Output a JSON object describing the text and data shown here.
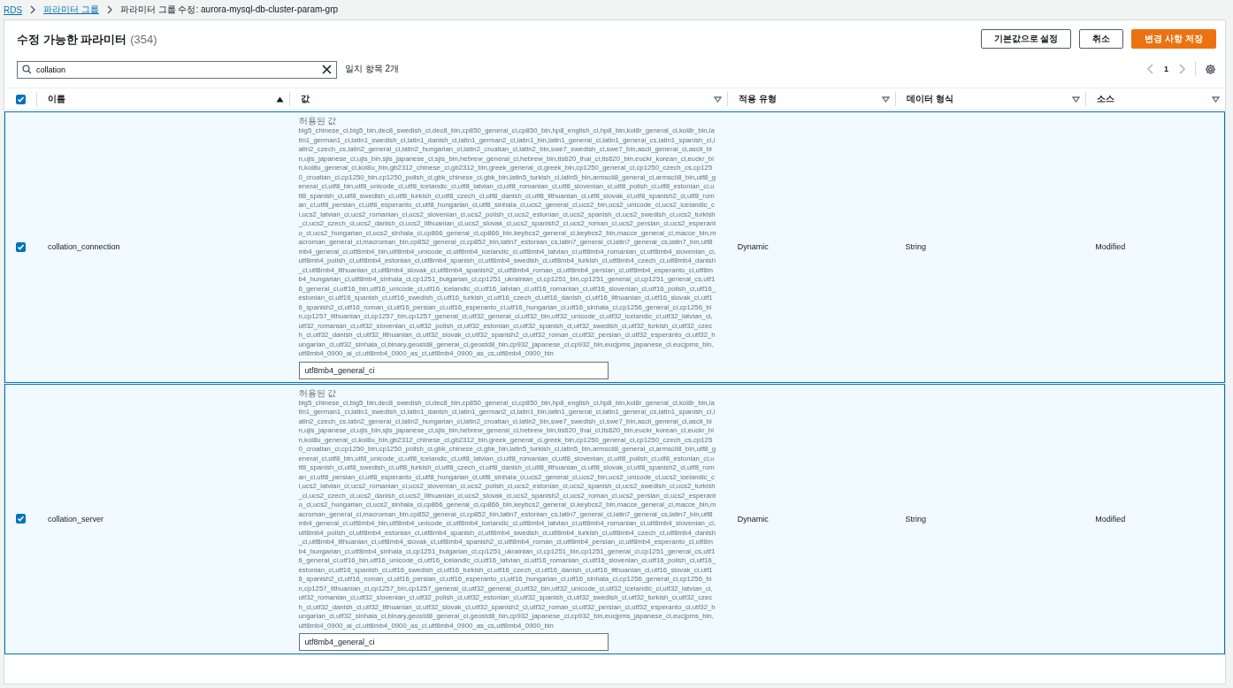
{
  "breadcrumb": [
    {
      "label": "RDS",
      "link": true
    },
    {
      "label": "파라미터 그룹",
      "link": true
    },
    {
      "label": "파라미터 그룹 수정: aurora-mysql-db-cluster-param-grp",
      "link": false
    }
  ],
  "panel": {
    "title": "수정 가능한 파라미터",
    "count": "(354)",
    "buttons": [
      {
        "label": "기본값으로 설정",
        "kind": "normal"
      },
      {
        "label": "취소",
        "kind": "normal"
      },
      {
        "label": "변경 사항 저장",
        "kind": "primary"
      }
    ]
  },
  "search": {
    "value": "collation",
    "match_count": "일치 항목 2개"
  },
  "pagination": {
    "pages": [
      {
        "label": "1",
        "selected": true
      }
    ]
  },
  "table": {
    "all_checked": true,
    "columns": [
      {
        "label": "이름",
        "sorted": true
      },
      {
        "label": "값",
        "sorted": false
      },
      {
        "label": "적용 유형",
        "sorted": false
      },
      {
        "label": "데이터 형식",
        "sorted": false
      },
      {
        "label": "소스",
        "sorted": false
      }
    ],
    "rows": [
      {
        "checked": true,
        "selected": true,
        "name": "collation_connection",
        "allowed_label": "허용된 값",
        "allowed_values": "big5_chinese_ci,big5_bin,dec8_swedish_ci,dec8_bin,cp850_general_ci,cp850_bin,hp8_english_ci,hp8_bin,koi8r_general_ci,koi8r_bin,latin1_german1_ci,latin1_swedish_ci,latin1_danish_ci,latin1_german2_ci,latin1_bin,latin1_general_ci,latin1_general_cs,latin1_spanish_ci,latin2_czech_cs,latin2_general_ci,latin2_hungarian_ci,latin2_croatian_ci,latin2_bin,swe7_swedish_ci,swe7_bin,ascii_general_ci,ascii_bin,ujis_japanese_ci,ujis_bin,sjis_japanese_ci,sjis_bin,hebrew_general_ci,hebrew_bin,tis620_thai_ci,tis620_bin,euckr_korean_ci,euckr_bin,koi8u_general_ci,koi8u_bin,gb2312_chinese_ci,gb2312_bin,greek_general_ci,greek_bin,cp1250_general_ci,cp1250_czech_cs,cp1250_croatian_ci,cp1250_bin,cp1250_polish_ci,gbk_chinese_ci,gbk_bin,latin5_turkish_ci,latin5_bin,armscii8_general_ci,armscii8_bin,utf8_general_ci,utf8_bin,utf8_unicode_ci,utf8_icelandic_ci,utf8_latvian_ci,utf8_romanian_ci,utf8_slovenian_ci,utf8_polish_ci,utf8_estonian_ci,utf8_spanish_ci,utf8_swedish_ci,utf8_turkish_ci,utf8_czech_ci,utf8_danish_ci,utf8_lithuanian_ci,utf8_slovak_ci,utf8_spanish2_ci,utf8_roman_ci,utf8_persian_ci,utf8_esperanto_ci,utf8_hungarian_ci,utf8_sinhala_ci,ucs2_general_ci,ucs2_bin,ucs2_unicode_ci,ucs2_icelandic_ci,ucs2_latvian_ci,ucs2_romanian_ci,ucs2_slovenian_ci,ucs2_polish_ci,ucs2_estonian_ci,ucs2_spanish_ci,ucs2_swedish_ci,ucs2_turkish_ci,ucs2_czech_ci,ucs2_danish_ci,ucs2_lithuanian_ci,ucs2_slovak_ci,ucs2_spanish2_ci,ucs2_roman_ci,ucs2_persian_ci,ucs2_esperanto_ci,ucs2_hungarian_ci,ucs2_sinhala_ci,cp866_general_ci,cp866_bin,keybcs2_general_ci,keybcs2_bin,macce_general_ci,macce_bin,macroman_general_ci,macroman_bin,cp852_general_ci,cp852_bin,latin7_estonian_cs,latin7_general_ci,latin7_general_cs,latin7_bin,utf8mb4_general_ci,utf8mb4_bin,utf8mb4_unicode_ci,utf8mb4_icelandic_ci,utf8mb4_latvian_ci,utf8mb4_romanian_ci,utf8mb4_slovenian_ci,utf8mb4_polish_ci,utf8mb4_estonian_ci,utf8mb4_spanish_ci,utf8mb4_swedish_ci,utf8mb4_turkish_ci,utf8mb4_czech_ci,utf8mb4_danish_ci,utf8mb4_lithuanian_ci,utf8mb4_slovak_ci,utf8mb4_spanish2_ci,utf8mb4_roman_ci,utf8mb4_persian_ci,utf8mb4_esperanto_ci,utf8mb4_hungarian_ci,utf8mb4_sinhala_ci,cp1251_bulgarian_ci,cp1251_ukrainian_ci,cp1251_bin,cp1251_general_ci,cp1251_general_cs,utf16_general_ci,utf16_bin,utf16_unicode_ci,utf16_icelandic_ci,utf16_latvian_ci,utf16_romanian_ci,utf16_slovenian_ci,utf16_polish_ci,utf16_estonian_ci,utf16_spanish_ci,utf16_swedish_ci,utf16_turkish_ci,utf16_czech_ci,utf16_danish_ci,utf16_lithuanian_ci,utf16_slovak_ci,utf16_spanish2_ci,utf16_roman_ci,utf16_persian_ci,utf16_esperanto_ci,utf16_hungarian_ci,utf16_sinhala_ci,cp1256_general_ci,cp1256_bin,cp1257_lithuanian_ci,cp1257_bin,cp1257_general_ci,utf32_general_ci,utf32_bin,utf32_unicode_ci,utf32_icelandic_ci,utf32_latvian_ci,utf32_romanian_ci,utf32_slovenian_ci,utf32_polish_ci,utf32_estonian_ci,utf32_spanish_ci,utf32_swedish_ci,utf32_turkish_ci,utf32_czech_ci,utf32_danish_ci,utf32_lithuanian_ci,utf32_slovak_ci,utf32_spanish2_ci,utf32_roman_ci,utf32_persian_ci,utf32_esperanto_ci,utf32_hungarian_ci,utf32_sinhala_ci,binary,geostd8_general_ci,geostd8_bin,cp932_japanese_ci,cp932_bin,eucjpms_japanese_ci,eucjpms_bin,utf8mb4_0900_ai_ci,utf8mb4_0900_as_ci,utf8mb4_0900_as_cs,utf8mb4_0900_bin",
        "value": "utf8mb4_general_ci",
        "apply_type": "Dynamic",
        "data_type": "String",
        "source": "Modified"
      },
      {
        "checked": true,
        "selected": true,
        "name": "collation_server",
        "allowed_label": "허용된 값",
        "allowed_values": "big5_chinese_ci,big5_bin,dec8_swedish_ci,dec8_bin,cp850_general_ci,cp850_bin,hp8_english_ci,hp8_bin,koi8r_general_ci,koi8r_bin,latin1_german1_ci,latin1_swedish_ci,latin1_danish_ci,latin1_german2_ci,latin1_bin,latin1_general_ci,latin1_general_cs,latin1_spanish_ci,latin2_czech_cs,latin2_general_ci,latin2_hungarian_ci,latin2_croatian_ci,latin2_bin,swe7_swedish_ci,swe7_bin,ascii_general_ci,ascii_bin,ujis_japanese_ci,ujis_bin,sjis_japanese_ci,sjis_bin,hebrew_general_ci,hebrew_bin,tis620_thai_ci,tis620_bin,euckr_korean_ci,euckr_bin,koi8u_general_ci,koi8u_bin,gb2312_chinese_ci,gb2312_bin,greek_general_ci,greek_bin,cp1250_general_ci,cp1250_czech_cs,cp1250_croatian_ci,cp1250_bin,cp1250_polish_ci,gbk_chinese_ci,gbk_bin,latin5_turkish_ci,latin5_bin,armscii8_general_ci,armscii8_bin,utf8_general_ci,utf8_bin,utf8_unicode_ci,utf8_icelandic_ci,utf8_latvian_ci,utf8_romanian_ci,utf8_slovenian_ci,utf8_polish_ci,utf8_estonian_ci,utf8_spanish_ci,utf8_swedish_ci,utf8_turkish_ci,utf8_czech_ci,utf8_danish_ci,utf8_lithuanian_ci,utf8_slovak_ci,utf8_spanish2_ci,utf8_roman_ci,utf8_persian_ci,utf8_esperanto_ci,utf8_hungarian_ci,utf8_sinhala_ci,ucs2_general_ci,ucs2_bin,ucs2_unicode_ci,ucs2_icelandic_ci,ucs2_latvian_ci,ucs2_romanian_ci,ucs2_slovenian_ci,ucs2_polish_ci,ucs2_estonian_ci,ucs2_spanish_ci,ucs2_swedish_ci,ucs2_turkish_ci,ucs2_czech_ci,ucs2_danish_ci,ucs2_lithuanian_ci,ucs2_slovak_ci,ucs2_spanish2_ci,ucs2_roman_ci,ucs2_persian_ci,ucs2_esperanto_ci,ucs2_hungarian_ci,ucs2_sinhala_ci,cp866_general_ci,cp866_bin,keybcs2_general_ci,keybcs2_bin,macce_general_ci,macce_bin,macroman_general_ci,macroman_bin,cp852_general_ci,cp852_bin,latin7_estonian_cs,latin7_general_ci,latin7_general_cs,latin7_bin,utf8mb4_general_ci,utf8mb4_bin,utf8mb4_unicode_ci,utf8mb4_icelandic_ci,utf8mb4_latvian_ci,utf8mb4_romanian_ci,utf8mb4_slovenian_ci,utf8mb4_polish_ci,utf8mb4_estonian_ci,utf8mb4_spanish_ci,utf8mb4_swedish_ci,utf8mb4_turkish_ci,utf8mb4_czech_ci,utf8mb4_danish_ci,utf8mb4_lithuanian_ci,utf8mb4_slovak_ci,utf8mb4_spanish2_ci,utf8mb4_roman_ci,utf8mb4_persian_ci,utf8mb4_esperanto_ci,utf8mb4_hungarian_ci,utf8mb4_sinhala_ci,cp1251_bulgarian_ci,cp1251_ukrainian_ci,cp1251_bin,cp1251_general_ci,cp1251_general_cs,utf16_general_ci,utf16_bin,utf16_unicode_ci,utf16_icelandic_ci,utf16_latvian_ci,utf16_romanian_ci,utf16_slovenian_ci,utf16_polish_ci,utf16_estonian_ci,utf16_spanish_ci,utf16_swedish_ci,utf16_turkish_ci,utf16_czech_ci,utf16_danish_ci,utf16_lithuanian_ci,utf16_slovak_ci,utf16_spanish2_ci,utf16_roman_ci,utf16_persian_ci,utf16_esperanto_ci,utf16_hungarian_ci,utf16_sinhala_ci,cp1256_general_ci,cp1256_bin,cp1257_lithuanian_ci,cp1257_bin,cp1257_general_ci,utf32_general_ci,utf32_bin,utf32_unicode_ci,utf32_icelandic_ci,utf32_latvian_ci,utf32_romanian_ci,utf32_slovenian_ci,utf32_polish_ci,utf32_estonian_ci,utf32_spanish_ci,utf32_swedish_ci,utf32_turkish_ci,utf32_czech_ci,utf32_danish_ci,utf32_lithuanian_ci,utf32_slovak_ci,utf32_spanish2_ci,utf32_roman_ci,utf32_persian_ci,utf32_esperanto_ci,utf32_hungarian_ci,utf32_sinhala_ci,binary,geostd8_general_ci,geostd8_bin,cp932_japanese_ci,cp932_bin,eucjpms_japanese_ci,eucjpms_bin,utf8mb4_0900_ai_ci,utf8mb4_0900_as_ci,utf8mb4_0900_as_cs,utf8mb4_0900_bin",
        "value": "utf8mb4_general_ci",
        "apply_type": "Dynamic",
        "data_type": "String",
        "source": "Modified"
      }
    ]
  }
}
